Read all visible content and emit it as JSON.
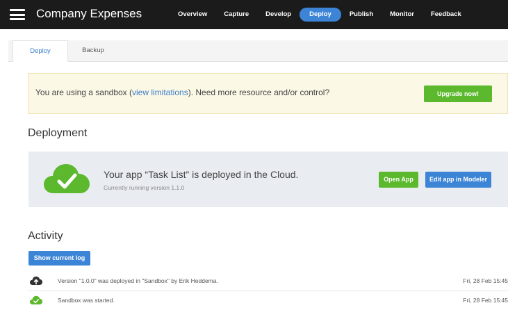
{
  "app": {
    "title": "Company Expenses"
  },
  "topnav": {
    "items": [
      {
        "label": "Overview"
      },
      {
        "label": "Capture"
      },
      {
        "label": "Develop"
      },
      {
        "label": "Deploy"
      },
      {
        "label": "Publish"
      },
      {
        "label": "Monitor"
      },
      {
        "label": "Feedback"
      }
    ],
    "active": "Deploy"
  },
  "tabs": [
    {
      "label": "Deploy",
      "active": true
    },
    {
      "label": "Backup",
      "active": false
    }
  ],
  "banner": {
    "text_before": "You are using a sandbox (",
    "link": "view limitations",
    "text_after": "). Need more resource and/or control?",
    "button": "Upgrade now!"
  },
  "deployment": {
    "title": "Deployment",
    "status": "Your app “Task List” is deployed in the Cloud.",
    "version": "Currently running version 1.1.0",
    "open_button": "Open App",
    "edit_button": "Edit app in Modeler"
  },
  "activity": {
    "title": "Activity",
    "log_button": "Show current log",
    "items": [
      {
        "icon": "cloud-upload-icon",
        "text": "Version \"1.0.0\" was deployed in \"Sandbox\" by Erik Heddema.",
        "time": "Fri, 28 Feb 15:45"
      },
      {
        "icon": "cloud-check-icon",
        "text": "Sandbox was started.",
        "time": "Fri, 28 Feb 15:45"
      }
    ]
  },
  "colors": {
    "topbar": "#1b1b1b",
    "accent_blue": "#3c84d6",
    "accent_green": "#5cb82c",
    "banner_bg": "#fcf8e6",
    "panel_bg": "#e9edf2"
  }
}
